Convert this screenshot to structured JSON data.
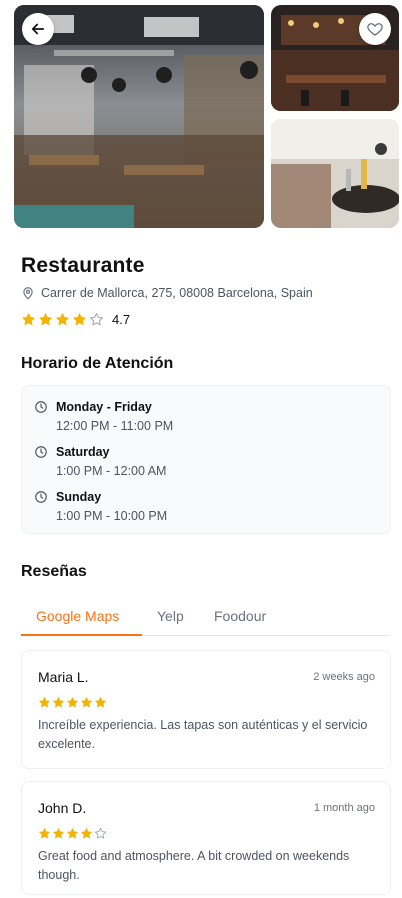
{
  "colors": {
    "accent": "#f97316",
    "star": "#f5b301",
    "card_bg": "#f8fafc",
    "muted": "#6b7280"
  },
  "gallery": {
    "back_icon": "arrow-left-icon",
    "favorite_icon": "heart-icon"
  },
  "restaurant": {
    "name": "Restaurante",
    "address": "Carrer de Mallorca, 275, 08008 Barcelona, Spain",
    "rating": "4.7",
    "rating_value": 4,
    "rating_max": 5
  },
  "hours": {
    "title": "Horario de Atención",
    "items": [
      {
        "day": "Monday - Friday",
        "time": "12:00 PM - 11:00 PM"
      },
      {
        "day": "Saturday",
        "time": "1:00 PM - 12:00 AM"
      },
      {
        "day": "Sunday",
        "time": "1:00 PM - 10:00 PM"
      }
    ]
  },
  "reviews": {
    "title": "Reseñas",
    "tabs": [
      {
        "label": "Google Maps",
        "active": true
      },
      {
        "label": "Yelp",
        "active": false
      },
      {
        "label": "Foodour",
        "active": false
      }
    ],
    "items": [
      {
        "name": "Maria L.",
        "date": "2 weeks ago",
        "stars": 5,
        "text": "Increíble experiencia. Las tapas son auténticas y el servicio excelente."
      },
      {
        "name": "John D.",
        "date": "1 month ago",
        "stars": 4,
        "text": "Great food and atmosphere. A bit crowded on weekends though."
      }
    ]
  }
}
